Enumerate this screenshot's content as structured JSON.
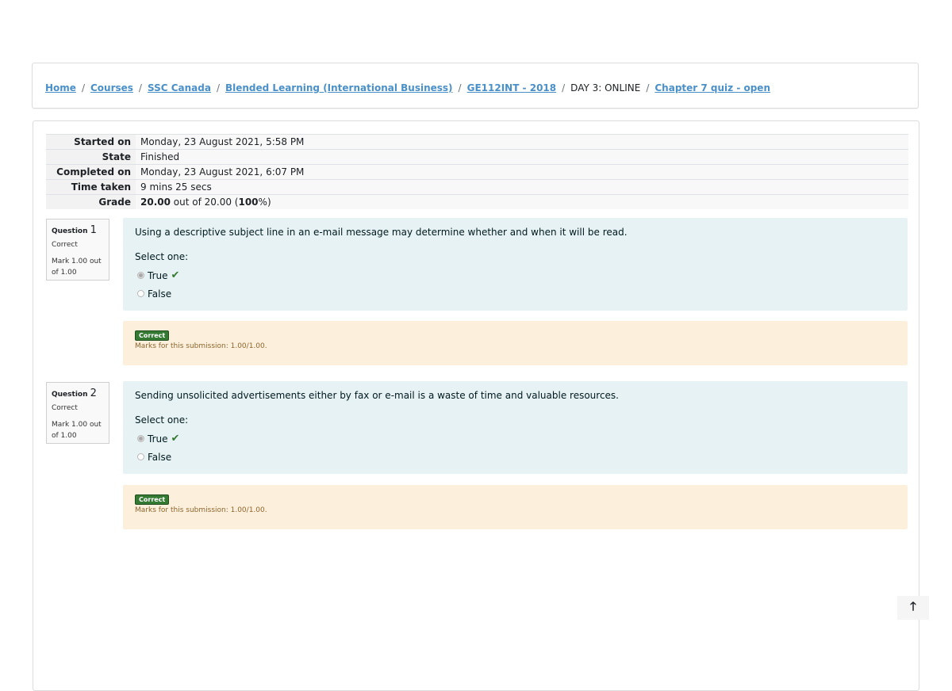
{
  "breadcrumb": [
    {
      "label": "Home",
      "link": true
    },
    {
      "label": "Courses",
      "link": true
    },
    {
      "label": "SSC Canada",
      "link": true
    },
    {
      "label": "Blended Learning (International Business)",
      "link": true
    },
    {
      "label": "GE112INT - 2018",
      "link": true
    },
    {
      "label": "DAY 3: ONLINE",
      "link": false
    },
    {
      "label": "Chapter 7 quiz - open",
      "link": true
    }
  ],
  "summary": {
    "started_label": "Started on",
    "started_value": "Monday, 23 August 2021, 5:58 PM",
    "state_label": "State",
    "state_value": "Finished",
    "completed_label": "Completed on",
    "completed_value": "Monday, 23 August 2021, 6:07 PM",
    "time_label": "Time taken",
    "time_value": "9 mins 25 secs",
    "grade_label": "Grade",
    "grade_score": "20.00",
    "grade_mid": " out of 20.00 (",
    "grade_percent": "100",
    "grade_end": "%)"
  },
  "questions": [
    {
      "label": "Question",
      "number": "1",
      "state": "Correct",
      "grade": "Mark 1.00 out of 1.00",
      "text": "Using a descriptive subject line in an e-mail message may determine whether and when it will be read.",
      "prompt": "Select one:",
      "option_true": "True",
      "option_false": "False",
      "badge": "Correct",
      "marks": "Marks for this submission: 1.00/1.00."
    },
    {
      "label": "Question",
      "number": "2",
      "state": "Correct",
      "grade": "Mark 1.00 out of 1.00",
      "text": "Sending unsolicited advertisements either by fax or e-mail is a waste of time and valuable resources.",
      "prompt": "Select one:",
      "option_true": "True",
      "option_false": "False",
      "badge": "Correct",
      "marks": "Marks for this submission: 1.00/1.00."
    }
  ],
  "icons": {
    "check": "check-icon",
    "back_to_top": "arrow-up-icon"
  },
  "colors": {
    "link": "#4a90c8",
    "correct": "#357a32",
    "formulation_bg": "#e7f2f5",
    "outcome_bg": "#fcefdc"
  }
}
